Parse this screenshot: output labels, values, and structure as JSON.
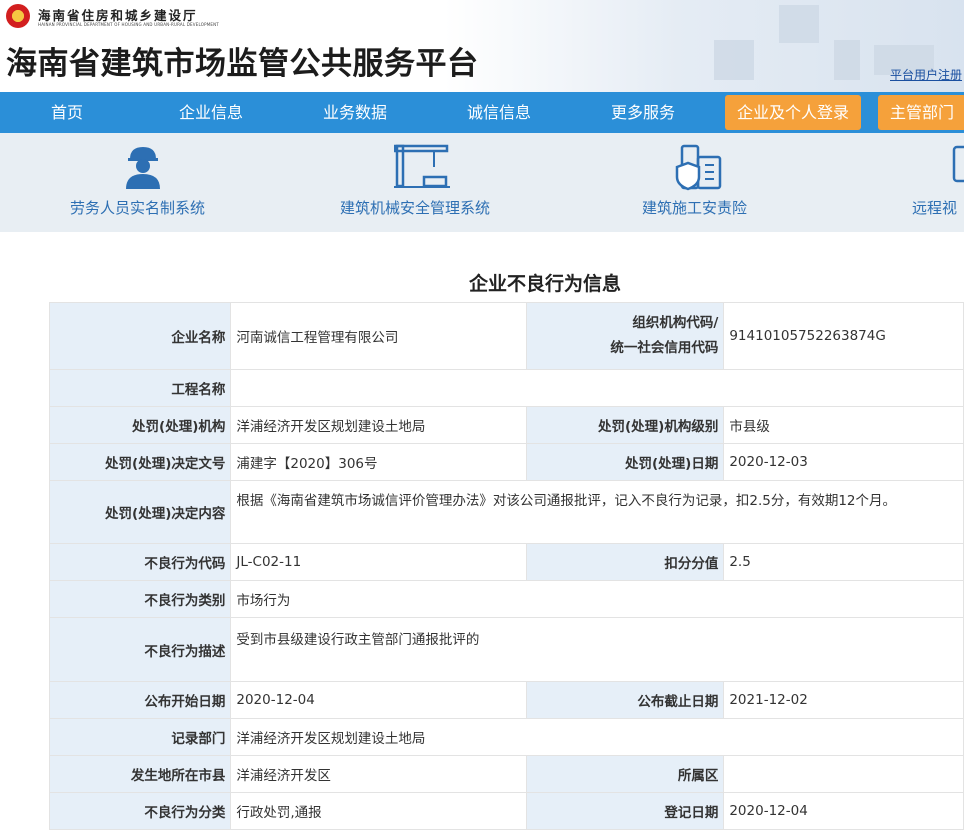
{
  "header": {
    "department_cn": "海南省住房和城乡建设厅",
    "department_en": "HAINAN PROVINCIAL DEPARTMENT OF HOUSING AND URBAN-RURAL DEVELOPMENT",
    "site_title": "海南省建筑市场监管公共服务平台",
    "user_register": "平台用户注册"
  },
  "nav": {
    "items": [
      "首页",
      "企业信息",
      "业务数据",
      "诚信信息",
      "更多服务"
    ],
    "login_button": "企业及个人登录",
    "authority_button": "主管部门"
  },
  "services": [
    {
      "label": "劳务人员实名制系统",
      "icon": "worker-icon"
    },
    {
      "label": "建筑机械安全管理系统",
      "icon": "tower-crane-icon"
    },
    {
      "label": "建筑施工安责险",
      "icon": "insurance-building-icon"
    },
    {
      "label": "远程视",
      "icon": "monitor-icon"
    }
  ],
  "page_title": "企业不良行为信息",
  "record": {
    "company_name_label": "企业名称",
    "company_name": "河南诚信工程管理有限公司",
    "org_code_label_1": "组织机构代码/",
    "org_code_label_2": "统一社会信用代码",
    "org_code": "91410105752263874G",
    "project_name_label": "工程名称",
    "project_name": "",
    "penalty_agency_label": "处罚(处理)机构",
    "penalty_agency": "洋浦经济开发区规划建设土地局",
    "agency_level_label": "处罚(处理)机构级别",
    "agency_level": "市县级",
    "decision_no_label": "处罚(处理)决定文号",
    "decision_no": "浦建字【2020】306号",
    "penalty_date_label": "处罚(处理)日期",
    "penalty_date": "2020-12-03",
    "decision_content_label": "处罚(处理)决定内容",
    "decision_content": "根据《海南省建筑市场诚信评价管理办法》对该公司通报批评，记入不良行为记录，扣2.5分，有效期12个月。",
    "behavior_code_label": "不良行为代码",
    "behavior_code": "JL-C02-11",
    "deduction_label": "扣分分值",
    "deduction": "2.5",
    "behavior_category_label": "不良行为类别",
    "behavior_category": "市场行为",
    "behavior_desc_label": "不良行为描述",
    "behavior_desc": "受到市县级建设行政主管部门通报批评的",
    "publish_start_label": "公布开始日期",
    "publish_start": "2020-12-04",
    "publish_end_label": "公布截止日期",
    "publish_end": "2021-12-02",
    "record_dept_label": "记录部门",
    "record_dept": "洋浦经济开发区规划建设土地局",
    "location_label": "发生地所在市县",
    "location": "洋浦经济开发区",
    "district_label": "所属区",
    "district": "",
    "classification_label": "不良行为分类",
    "classification": "行政处罚,通报",
    "register_date_label": "登记日期",
    "register_date": "2020-12-04"
  },
  "colors": {
    "nav_bg": "#2b8fd8",
    "login_button_bg": "#f5a13b",
    "service_bar_bg": "#e8eef3",
    "service_text": "#2d6fb3",
    "label_cell_bg": "#e6eff8"
  }
}
